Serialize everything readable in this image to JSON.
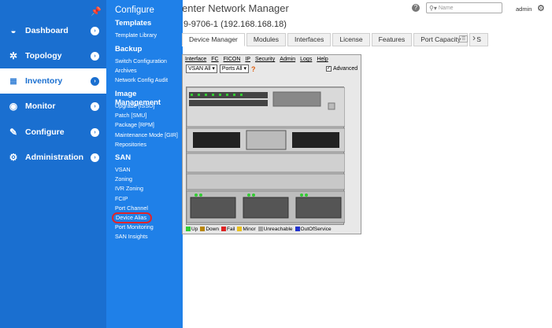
{
  "sidebar": {
    "items": [
      {
        "label": "Dashboard",
        "icon": "dashboard-icon",
        "glyph": "◒"
      },
      {
        "label": "Topology",
        "icon": "topology-icon",
        "glyph": "✲"
      },
      {
        "label": "Inventory",
        "icon": "inventory-icon",
        "glyph": "≣"
      },
      {
        "label": "Monitor",
        "icon": "monitor-icon",
        "glyph": "◉"
      },
      {
        "label": "Configure",
        "icon": "configure-icon",
        "glyph": "✎"
      },
      {
        "label": "Administration",
        "icon": "administration-icon",
        "glyph": "⚙"
      }
    ],
    "active_index": 2
  },
  "flyout": {
    "title": "Configure",
    "sections": [
      {
        "heading": "Templates",
        "items": [
          "Template Library"
        ]
      },
      {
        "heading": "Backup",
        "items": [
          "Switch Configuration",
          "Archives",
          "Network Config Audit"
        ]
      },
      {
        "heading": "Image Management",
        "items": [
          "Upgrade [ISSU]",
          "Patch [SMU]",
          "Package [RPM]",
          "Maintenance Mode [GIR]",
          "Repositories"
        ]
      },
      {
        "heading": "SAN",
        "items": [
          "VSAN",
          "Zoning",
          "IVR Zoning",
          "FCIP",
          "Port Channel",
          "Device Alias",
          "Port Monitoring",
          "SAN Insights"
        ]
      }
    ],
    "highlighted_item": "Device Alias"
  },
  "header": {
    "app_title": "enter Network Manager",
    "search_placeholder": "Name",
    "user": "admin",
    "device_title": "9-9706-1 (192.168.168.18)"
  },
  "tabs": [
    {
      "label": "Device Manager",
      "active": true
    },
    {
      "label": "Modules",
      "active": false
    },
    {
      "label": "Interfaces",
      "active": false
    },
    {
      "label": "License",
      "active": false
    },
    {
      "label": "Features",
      "active": false
    },
    {
      "label": "Port Capacity",
      "active": false
    },
    {
      "label": "S",
      "active": false
    }
  ],
  "device_manager": {
    "menu": [
      "Interface",
      "FC",
      "FICON",
      "IP",
      "Security",
      "Admin",
      "Logs",
      "Help"
    ],
    "vsan_select": "VSAN All",
    "ports_select": "Ports All",
    "advanced_label": "Advanced",
    "advanced_checked": true,
    "legend": [
      {
        "label": "Up",
        "color": "#33cc33"
      },
      {
        "label": "Down",
        "color": "#b8860b"
      },
      {
        "label": "Fail",
        "color": "#dd2222"
      },
      {
        "label": "Minor",
        "color": "#e8c020"
      },
      {
        "label": "Unreachable",
        "color": "#a0a0a0"
      },
      {
        "label": "OutOfService",
        "color": "#2233cc"
      }
    ]
  },
  "colors": {
    "sidebar_bg": "#1a6fd0",
    "flyout_bg": "#1f80e8",
    "highlight": "#e0252b"
  }
}
